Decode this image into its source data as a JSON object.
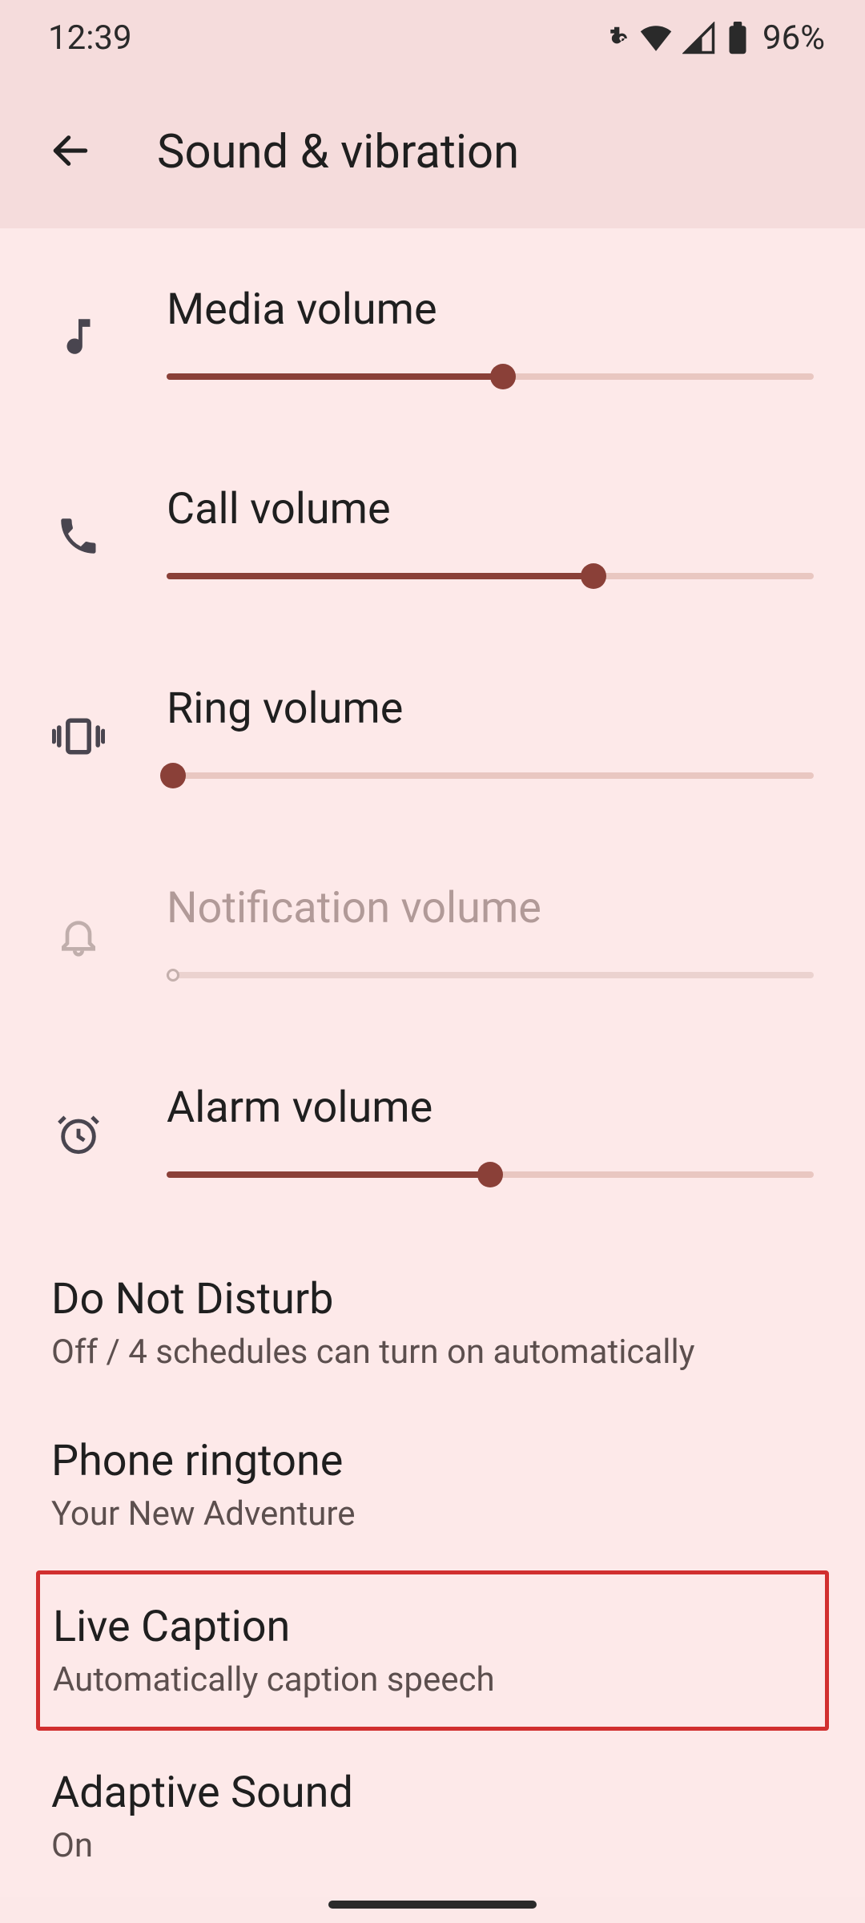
{
  "status": {
    "time": "12:39",
    "battery": "96%"
  },
  "header": {
    "title": "Sound & vibration"
  },
  "sliders": {
    "media": {
      "label": "Media volume",
      "percent": 52,
      "disabled": false
    },
    "call": {
      "label": "Call volume",
      "percent": 66,
      "disabled": false
    },
    "ring": {
      "label": "Ring volume",
      "percent": 1,
      "disabled": false
    },
    "notification": {
      "label": "Notification volume",
      "percent": 1,
      "disabled": true
    },
    "alarm": {
      "label": "Alarm volume",
      "percent": 50,
      "disabled": false
    }
  },
  "items": {
    "dnd": {
      "title": "Do Not Disturb",
      "sub": "Off / 4 schedules can turn on automatically"
    },
    "ringtone": {
      "title": "Phone ringtone",
      "sub": "Your New Adventure"
    },
    "live": {
      "title": "Live Caption",
      "sub": "Automatically caption speech"
    },
    "adaptive": {
      "title": "Adaptive Sound",
      "sub": "On"
    }
  }
}
